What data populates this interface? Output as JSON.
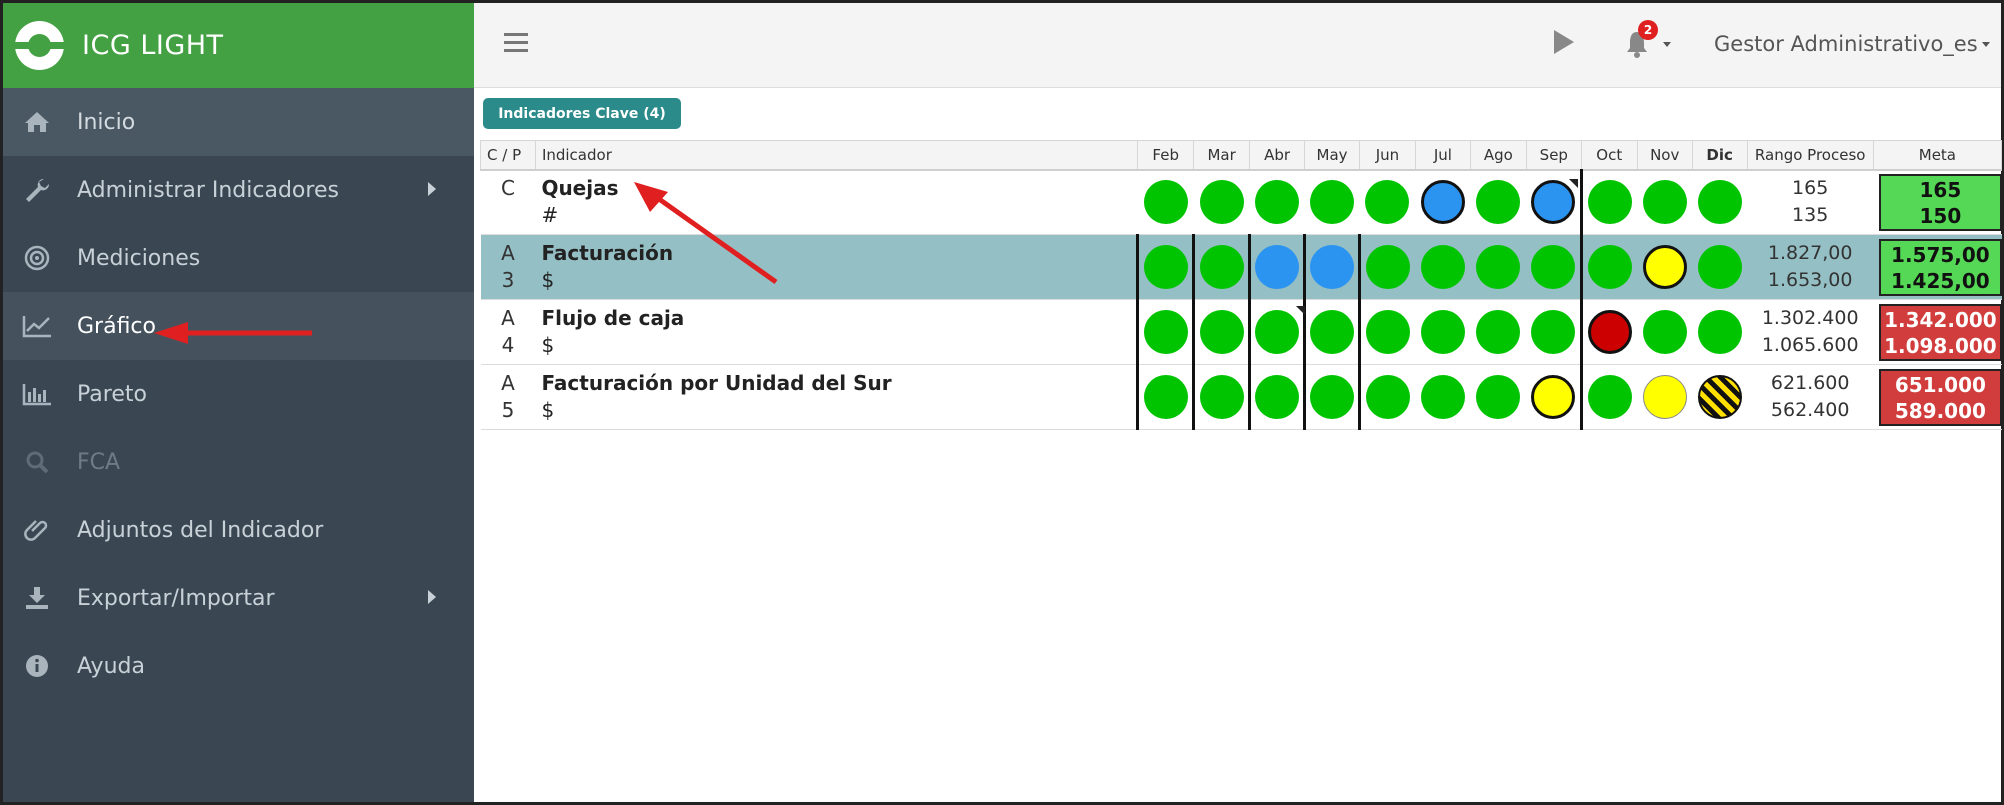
{
  "brand": {
    "title": "ICG LIGHT"
  },
  "sidebar": {
    "items": [
      {
        "label": "Inicio",
        "icon": "home-icon"
      },
      {
        "label": "Administrar Indicadores",
        "icon": "wrench-icon"
      },
      {
        "label": "Mediciones",
        "icon": "target-icon"
      },
      {
        "label": "Gráfico",
        "icon": "line-chart-icon"
      },
      {
        "label": "Pareto",
        "icon": "bar-chart-icon"
      },
      {
        "label": "FCA",
        "icon": "search-icon"
      },
      {
        "label": "Adjuntos del Indicador",
        "icon": "paperclip-icon"
      },
      {
        "label": "Exportar/Importar",
        "icon": "download-icon"
      },
      {
        "label": "Ayuda",
        "icon": "info-icon"
      }
    ]
  },
  "topbar": {
    "notifications": "2",
    "user": "Gestor Administrativo_es"
  },
  "tab": {
    "label": "Indicadores Clave (4)"
  },
  "table": {
    "headers": {
      "cp": "C / P",
      "indicador": "Indicador",
      "rango": "Rango Proceso",
      "meta": "Meta"
    },
    "months": [
      "Feb",
      "Mar",
      "Abr",
      "May",
      "Jun",
      "Jul",
      "Ago",
      "Sep",
      "Oct",
      "Nov",
      "Dic"
    ],
    "rows": [
      {
        "cp1": "C",
        "cp2": "",
        "name": "Quejas",
        "unit": "#",
        "rango_hi": "165",
        "rango_lo": "135",
        "meta_hi": "165",
        "meta_lo": "150",
        "meta_color": "green",
        "status": [
          "green",
          "green",
          "green",
          "green",
          "green",
          "blue-ring",
          "green",
          "blue-ring",
          "green",
          "green",
          "green"
        ]
      },
      {
        "cp1": "A",
        "cp2": "3",
        "name": "Facturación",
        "unit": "$",
        "rango_hi": "1.827,00",
        "rango_lo": "1.653,00",
        "meta_hi": "1.575,00",
        "meta_lo": "1.425,00",
        "meta_color": "green",
        "status": [
          "green",
          "green",
          "blue",
          "blue",
          "green",
          "green",
          "green",
          "green",
          "green",
          "yellow-ring",
          "green"
        ]
      },
      {
        "cp1": "A",
        "cp2": "4",
        "name": "Flujo de caja",
        "unit": "$",
        "rango_hi": "1.302.400",
        "rango_lo": "1.065.600",
        "meta_hi": "1.342.000",
        "meta_lo": "1.098.000",
        "meta_color": "red",
        "status": [
          "green",
          "green",
          "green",
          "green",
          "green",
          "green",
          "green",
          "green",
          "red-ring",
          "green",
          "green"
        ]
      },
      {
        "cp1": "A",
        "cp2": "5",
        "name": "Facturación por Unidad del Sur",
        "unit": "$",
        "rango_hi": "621.600",
        "rango_lo": "562.400",
        "meta_hi": "651.000",
        "meta_lo": "589.000",
        "meta_color": "red",
        "status": [
          "green",
          "green",
          "green",
          "green",
          "green",
          "green",
          "green",
          "yellow-ring",
          "green",
          "yellow",
          "hatched"
        ]
      }
    ]
  },
  "colors": {
    "sidebar": "#3a4752",
    "brand": "#43a043",
    "selected_row": "#94bfc4",
    "tab": "#2b8a8a"
  }
}
